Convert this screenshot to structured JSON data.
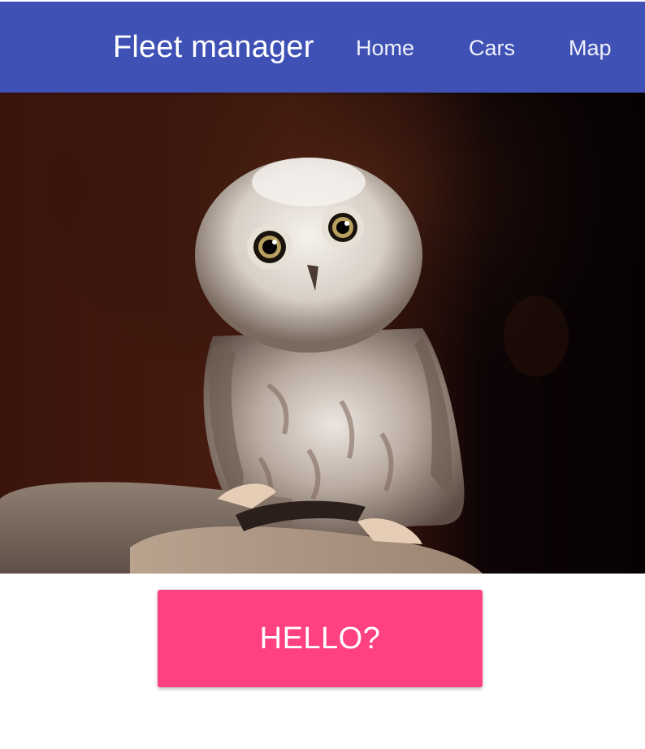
{
  "toolbar": {
    "title": "Fleet manager",
    "nav": [
      {
        "label": "Home"
      },
      {
        "label": "Cars"
      },
      {
        "label": "Map"
      }
    ],
    "background_color": "#3f51b5"
  },
  "hero": {
    "subject": "owl-photo"
  },
  "action": {
    "button_label": "HELLO?",
    "button_color": "#ff4081"
  }
}
